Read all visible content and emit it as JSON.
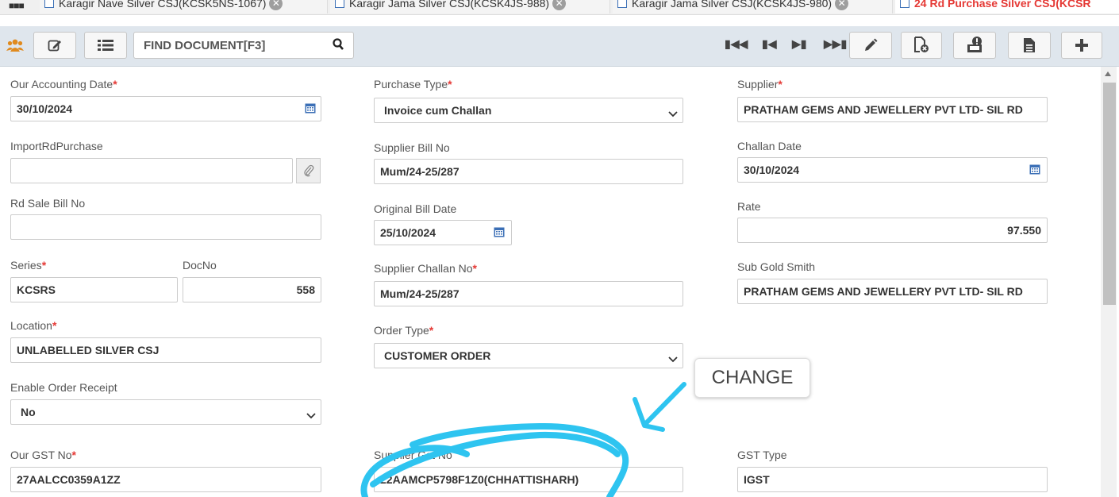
{
  "tabs": [
    {
      "label": "Karagir Nave Silver CSJ(KCSK5NS-1067)"
    },
    {
      "label": "Karagir Jama Silver CSJ(KCSK4JS-988)"
    },
    {
      "label": "Karagir Jama Silver CSJ(KCSK4JS-980)"
    },
    {
      "label": "24 Rd Purchase Silver CSJ(KCSR"
    }
  ],
  "toolbar": {
    "search_placeholder": "FIND DOCUMENT[F3]",
    "icons": [
      "users-icon",
      "edit-icon",
      "list-icon",
      "search-icon",
      "first-icon",
      "prev-icon",
      "next-icon",
      "last-icon",
      "pencil-icon",
      "cancel-doc-icon",
      "approval-icon",
      "document-icon",
      "plus-icon"
    ]
  },
  "form": {
    "our_accounting_date": {
      "label": "Our Accounting Date",
      "value": "30/10/2024"
    },
    "purchase_type": {
      "label": "Purchase Type",
      "value": "Invoice cum Challan"
    },
    "supplier": {
      "label": "Supplier",
      "value": "PRATHAM GEMS AND JEWELLERY PVT LTD- SIL RD"
    },
    "import_rd_purchase": {
      "label": "ImportRdPurchase",
      "value": ""
    },
    "supplier_bill_no": {
      "label": "Supplier Bill No",
      "value": "Mum/24-25/287"
    },
    "challan_date": {
      "label": "Challan Date",
      "value": "30/10/2024"
    },
    "rd_sale_bill_no": {
      "label": "Rd Sale Bill No",
      "value": ""
    },
    "original_bill_date": {
      "label": "Original Bill Date",
      "value": "25/10/2024"
    },
    "rate": {
      "label": "Rate",
      "value": "97.550"
    },
    "series": {
      "label": "Series",
      "value": "KCSRS"
    },
    "doc_no": {
      "label": "DocNo",
      "value": "558"
    },
    "supplier_challan_no": {
      "label": "Supplier Challan No",
      "value": "Mum/24-25/287"
    },
    "sub_gold_smith": {
      "label": "Sub Gold Smith",
      "value": "PRATHAM GEMS AND JEWELLERY PVT LTD- SIL RD"
    },
    "location": {
      "label": "Location",
      "value": "UNLABELLED SILVER CSJ"
    },
    "order_type": {
      "label": "Order Type",
      "value": "CUSTOMER ORDER"
    },
    "enable_order_receipt": {
      "label": "Enable Order Receipt",
      "value": "No"
    },
    "our_gst_no": {
      "label": "Our GST No",
      "value": "27AALCC0359A1ZZ"
    },
    "supplier_gst_no": {
      "label": "Supplier Gst No",
      "value": "22AAMCP5798F1Z0(CHHATTISHARH)"
    },
    "gst_type": {
      "label": "GST Type",
      "value": "IGST"
    },
    "required_mark": "*"
  },
  "annotation": {
    "callout_text": "CHANGE",
    "color": "#2ec4f0"
  },
  "colors": {
    "toolbar_bg": "#dfe6ed",
    "required": "#e53935",
    "calendar_icon": "#3b6fb6",
    "users_icon": "#e08a1e"
  }
}
